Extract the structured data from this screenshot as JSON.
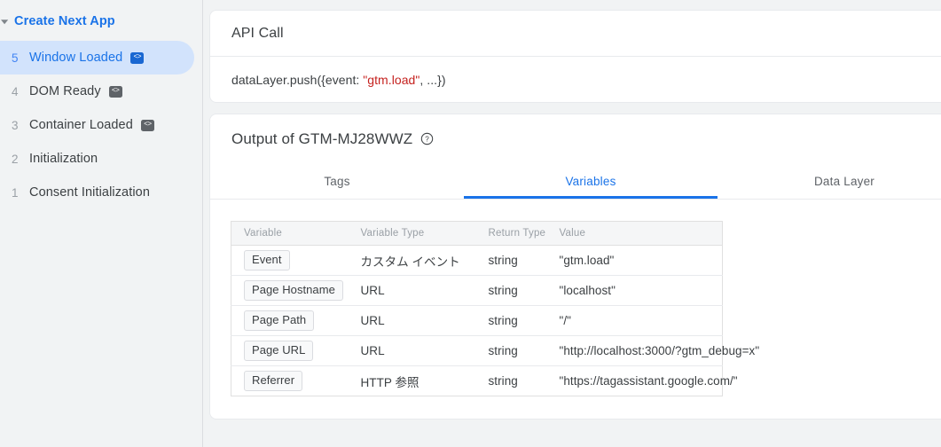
{
  "sidebar": {
    "caret_icon": "caret-down-icon",
    "app_title": "Create Next App",
    "items": [
      {
        "num": "5",
        "label": "Window Loaded",
        "badge": "<>",
        "has_badge": true,
        "active": true
      },
      {
        "num": "4",
        "label": "DOM Ready",
        "badge": "<>",
        "has_badge": true,
        "active": false
      },
      {
        "num": "3",
        "label": "Container Loaded",
        "badge": "<>",
        "has_badge": true,
        "active": false
      },
      {
        "num": "2",
        "label": "Initialization",
        "badge": "",
        "has_badge": false,
        "active": false
      },
      {
        "num": "1",
        "label": "Consent Initialization",
        "badge": "",
        "has_badge": false,
        "active": false
      }
    ]
  },
  "api_call": {
    "title": "API Call",
    "code_prefix": "dataLayer.push({event: ",
    "code_string": "\"gtm.load\"",
    "code_suffix": ", ...})"
  },
  "output": {
    "title": "Output of GTM-MJ28WWZ",
    "help_icon": "help-circle-icon",
    "tabs": [
      {
        "label": "Tags",
        "active": false
      },
      {
        "label": "Variables",
        "active": true
      },
      {
        "label": "Data Layer",
        "active": false
      }
    ],
    "table": {
      "columns": [
        "Variable",
        "Variable Type",
        "Return Type",
        "Value"
      ],
      "rows": [
        {
          "variable": "Event",
          "variable_type": "カスタム イベント",
          "return_type": "string",
          "value": "\"gtm.load\""
        },
        {
          "variable": "Page Hostname",
          "variable_type": "URL",
          "return_type": "string",
          "value": "\"localhost\""
        },
        {
          "variable": "Page Path",
          "variable_type": "URL",
          "return_type": "string",
          "value": "\"/\""
        },
        {
          "variable": "Page URL",
          "variable_type": "URL",
          "return_type": "string",
          "value": "\"http://localhost:3000/?gtm_debug=x\""
        },
        {
          "variable": "Referrer",
          "variable_type": "HTTP 参照",
          "return_type": "string",
          "value": "\"https://tagassistant.google.com/\""
        }
      ]
    }
  },
  "colors": {
    "accent": "#1a73e8",
    "active_pill": "#d2e3fc",
    "page_bg": "#f1f3f4",
    "card_bg": "#ffffff",
    "string_red": "#c5221f",
    "muted_text": "#9aa0a6"
  }
}
